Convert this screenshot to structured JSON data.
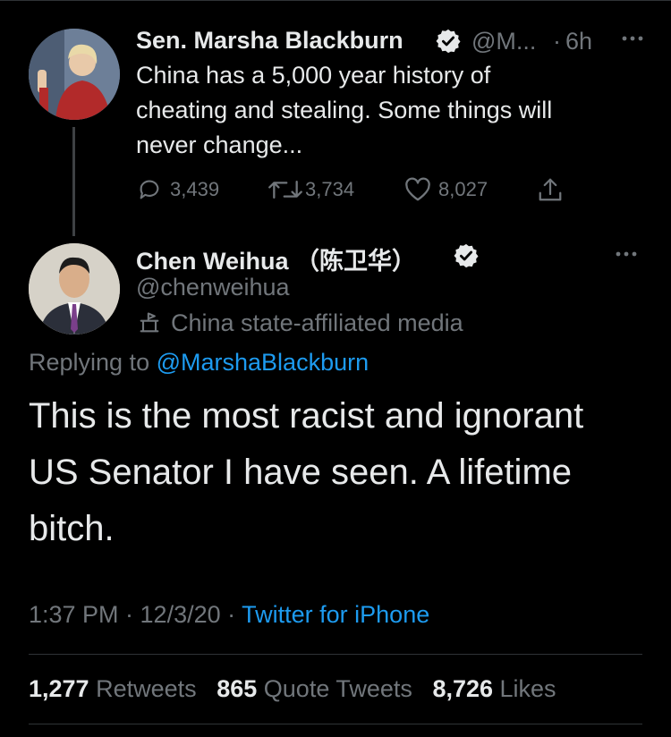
{
  "tweet1": {
    "name": "Sen. Marsha Blackburn",
    "handle": "@M...",
    "dot": "·",
    "time": "6h",
    "text_lines": [
      "China has a 5,000 year history of",
      "cheating and stealing. Some things will",
      "never change..."
    ],
    "replies": "3,439",
    "retweets": "3,734",
    "likes": "8,027"
  },
  "tweet2": {
    "name": "Chen Weihua （陈卫华）",
    "handle": "@chenweihua",
    "label": "China state-affiliated media",
    "replying_prefix": "Replying to",
    "replying_to": "@MarshaBlackburn",
    "text_lines": [
      "This is the most racist and ignorant",
      "US Senator I have seen.  A lifetime",
      "bitch."
    ],
    "timestamp": "1:37 PM · 12/3/20 ·",
    "source": "Twitter for iPhone",
    "stats": {
      "retweets_num": "1,277",
      "retweets_label": "Retweets",
      "quotes_num": "865",
      "quotes_label": "Quote Tweets",
      "likes_num": "8,726",
      "likes_label": "Likes"
    }
  },
  "colors": {
    "background": "#000000",
    "text": "#e7e9ea",
    "secondary": "#71767b",
    "link": "#1d9bf0"
  },
  "icons": [
    "verified-badge-icon",
    "more-icon",
    "reply-icon",
    "retweet-icon",
    "like-icon",
    "share-icon",
    "state-media-icon"
  ]
}
